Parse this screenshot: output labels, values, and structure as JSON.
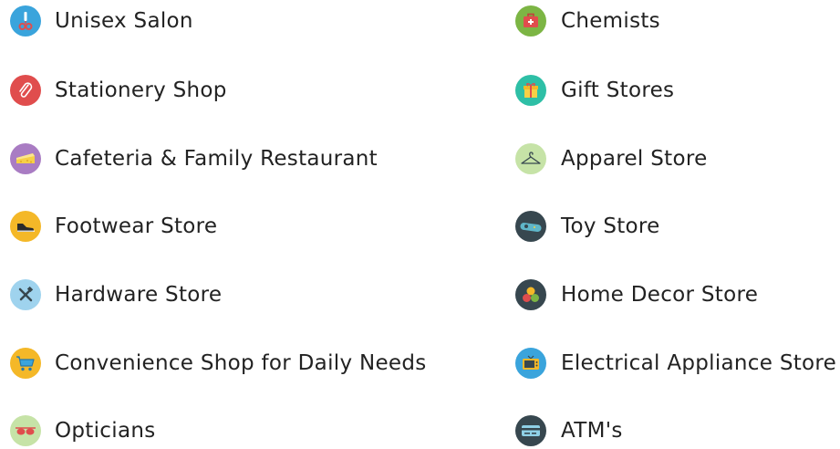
{
  "categories_left": [
    {
      "label": "Unisex Salon",
      "icon": "scissors-icon",
      "color": "#3aa4dc"
    },
    {
      "label": "Stationery Shop",
      "icon": "paperclip-icon",
      "color": "#e04d4d"
    },
    {
      "label": "Cafeteria & Family Restaurant",
      "icon": "cake-icon",
      "color": "#a97cc3"
    },
    {
      "label": "Footwear Store",
      "icon": "shoe-icon",
      "color": "#f4b828"
    },
    {
      "label": "Hardware Store",
      "icon": "tools-icon",
      "color": "#9fd3ee"
    },
    {
      "label": "Convenience Shop for Daily Needs",
      "icon": "shopping-cart-icon",
      "color": "#f4b828"
    },
    {
      "label": "Opticians",
      "icon": "sunglasses-icon",
      "color": "#c6e3a7"
    }
  ],
  "categories_right": [
    {
      "label": "Chemists",
      "icon": "first-aid-kit-icon",
      "color": "#7cb544"
    },
    {
      "label": "Gift Stores",
      "icon": "gift-icon",
      "color": "#2ebfa6"
    },
    {
      "label": "Apparel Store",
      "icon": "hanger-icon",
      "color": "#c6e3a7"
    },
    {
      "label": "Toy Store",
      "icon": "game-controller-icon",
      "color": "#37474f"
    },
    {
      "label": "Home Decor Store",
      "icon": "decor-balls-icon",
      "color": "#37474f"
    },
    {
      "label": "Electrical Appliance Store",
      "icon": "television-icon",
      "color": "#3aa4dc"
    },
    {
      "label": "ATM's",
      "icon": "atm-card-icon",
      "color": "#37474f"
    }
  ]
}
